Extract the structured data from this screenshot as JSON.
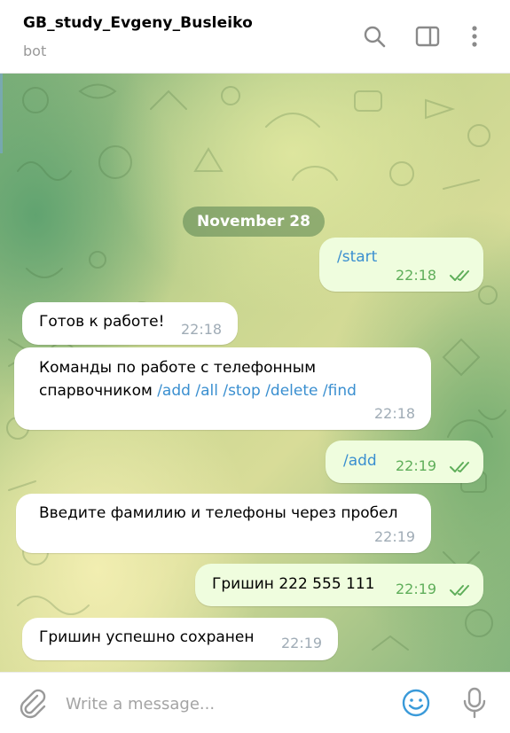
{
  "header": {
    "title": "GB_study_Evgeny_Busleiko",
    "status": "bot",
    "icons": [
      "search-icon",
      "sidebar-toggle-icon",
      "more-vertical-icon"
    ]
  },
  "chat": {
    "date_label": "November 28",
    "messages": [
      {
        "direction": "out",
        "text": "/start",
        "time": "22:18",
        "read": true
      },
      {
        "direction": "in",
        "text": "Готов к работе!",
        "time": "22:18"
      },
      {
        "direction": "in",
        "text_line1": "Команды по работе с телефонным",
        "text_line2_prefix": "спарвочником",
        "commands": [
          "/add",
          "/all",
          "/stop",
          "/delete",
          "/find"
        ],
        "time": "22:18"
      },
      {
        "direction": "out",
        "text": "/add",
        "time": "22:19",
        "read": true
      },
      {
        "direction": "in",
        "text": "Введите фамилию и телефоны через пробел",
        "time": "22:19"
      },
      {
        "direction": "out",
        "text": "Гришин 222 555 111",
        "time": "22:19",
        "read": true
      },
      {
        "direction": "in",
        "text": "Гришин успешно сохранен",
        "time": "22:19"
      }
    ]
  },
  "composer": {
    "placeholder": "Write a message...",
    "value": "",
    "icons": [
      "paperclip-icon",
      "emoji-icon",
      "microphone-icon"
    ]
  },
  "colors": {
    "outgoing_bubble": "#effdde",
    "incoming_bubble": "#ffffff",
    "command_link": "#3a8fd0",
    "read_checks": "#5fae5a",
    "accent": "#3a9ad9"
  }
}
